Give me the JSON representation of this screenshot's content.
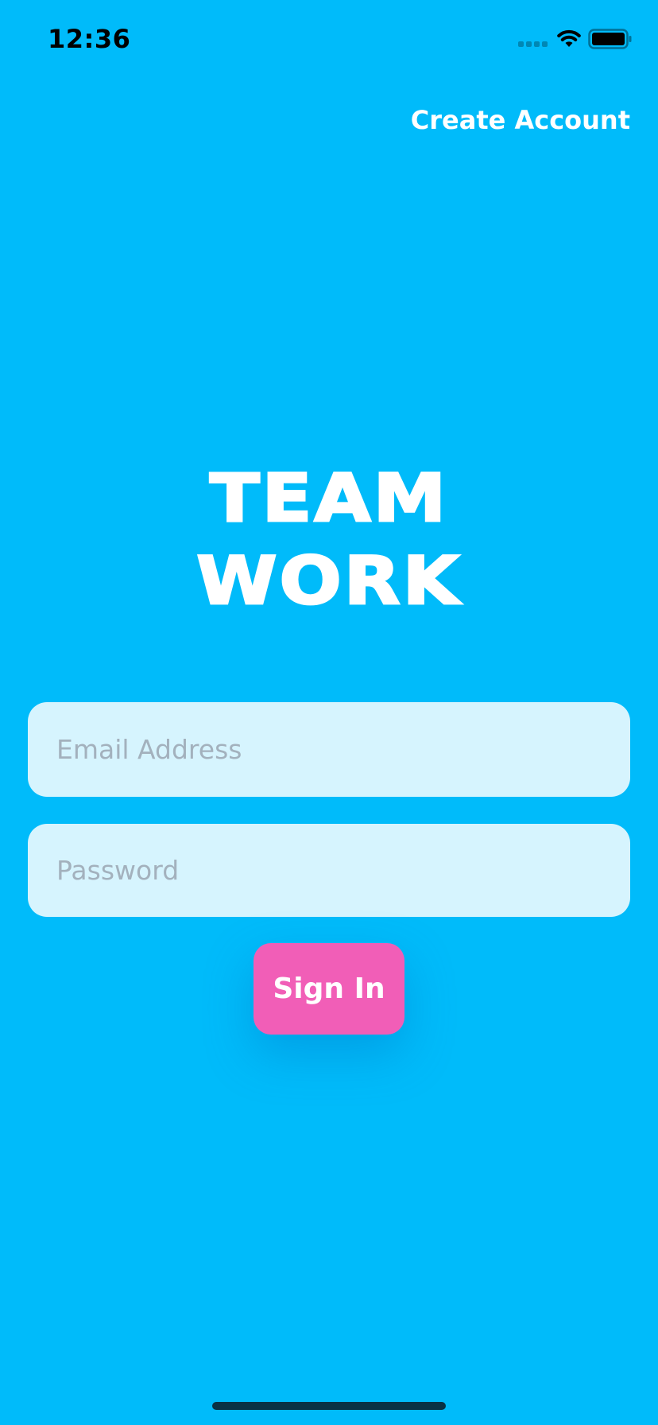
{
  "status_bar": {
    "time": "12:36"
  },
  "header": {
    "create_account_label": "Create Account"
  },
  "logo": {
    "line1": "TEAM",
    "line2": "WORK"
  },
  "form": {
    "email_placeholder": "Email Address",
    "email_value": "",
    "password_placeholder": "Password",
    "password_value": "",
    "signin_label": "Sign In"
  },
  "icons": {
    "signal": "cellular-signal-icon",
    "wifi": "wifi-icon",
    "battery": "battery-icon"
  },
  "colors": {
    "background": "#00BBFA",
    "field_background": "#D6F4FE",
    "signin_button": "#F15EB7",
    "text_light": "#FFFFFF"
  }
}
